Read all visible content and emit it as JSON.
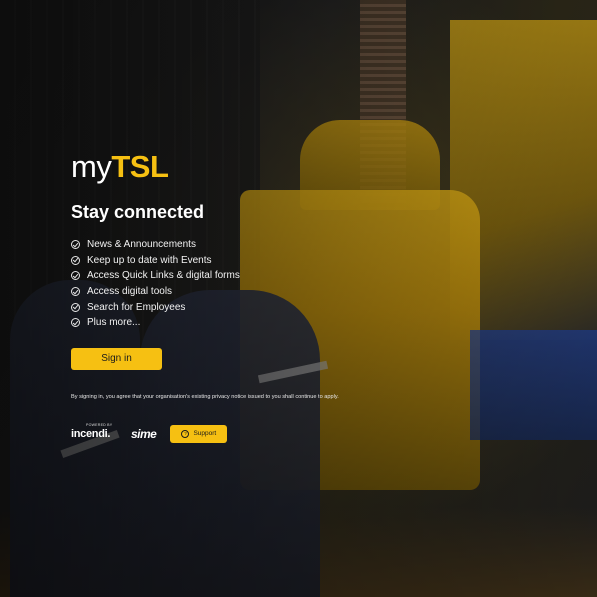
{
  "brand": {
    "prefix": "my",
    "name": "TSL"
  },
  "headline": "Stay connected",
  "features": [
    "News & Announcements",
    "Keep up to date with Events",
    "Access Quick Links & digital forms",
    "Access digital tools",
    "Search for Employees",
    "Plus more..."
  ],
  "signin_label": "Sign in",
  "privacy_notice": "By signing in, you agree that your organisation's existing privacy notice issued to you shall continue to apply.",
  "footer": {
    "powered_by": "POWERED BY",
    "incendi": "incendi.",
    "sime": "sime",
    "support_label": "Support",
    "support_icon": "?"
  },
  "colors": {
    "accent": "#f6c012",
    "text": "#ffffff"
  },
  "icons": {
    "feature": "check-circle-icon",
    "support": "help-icon"
  }
}
